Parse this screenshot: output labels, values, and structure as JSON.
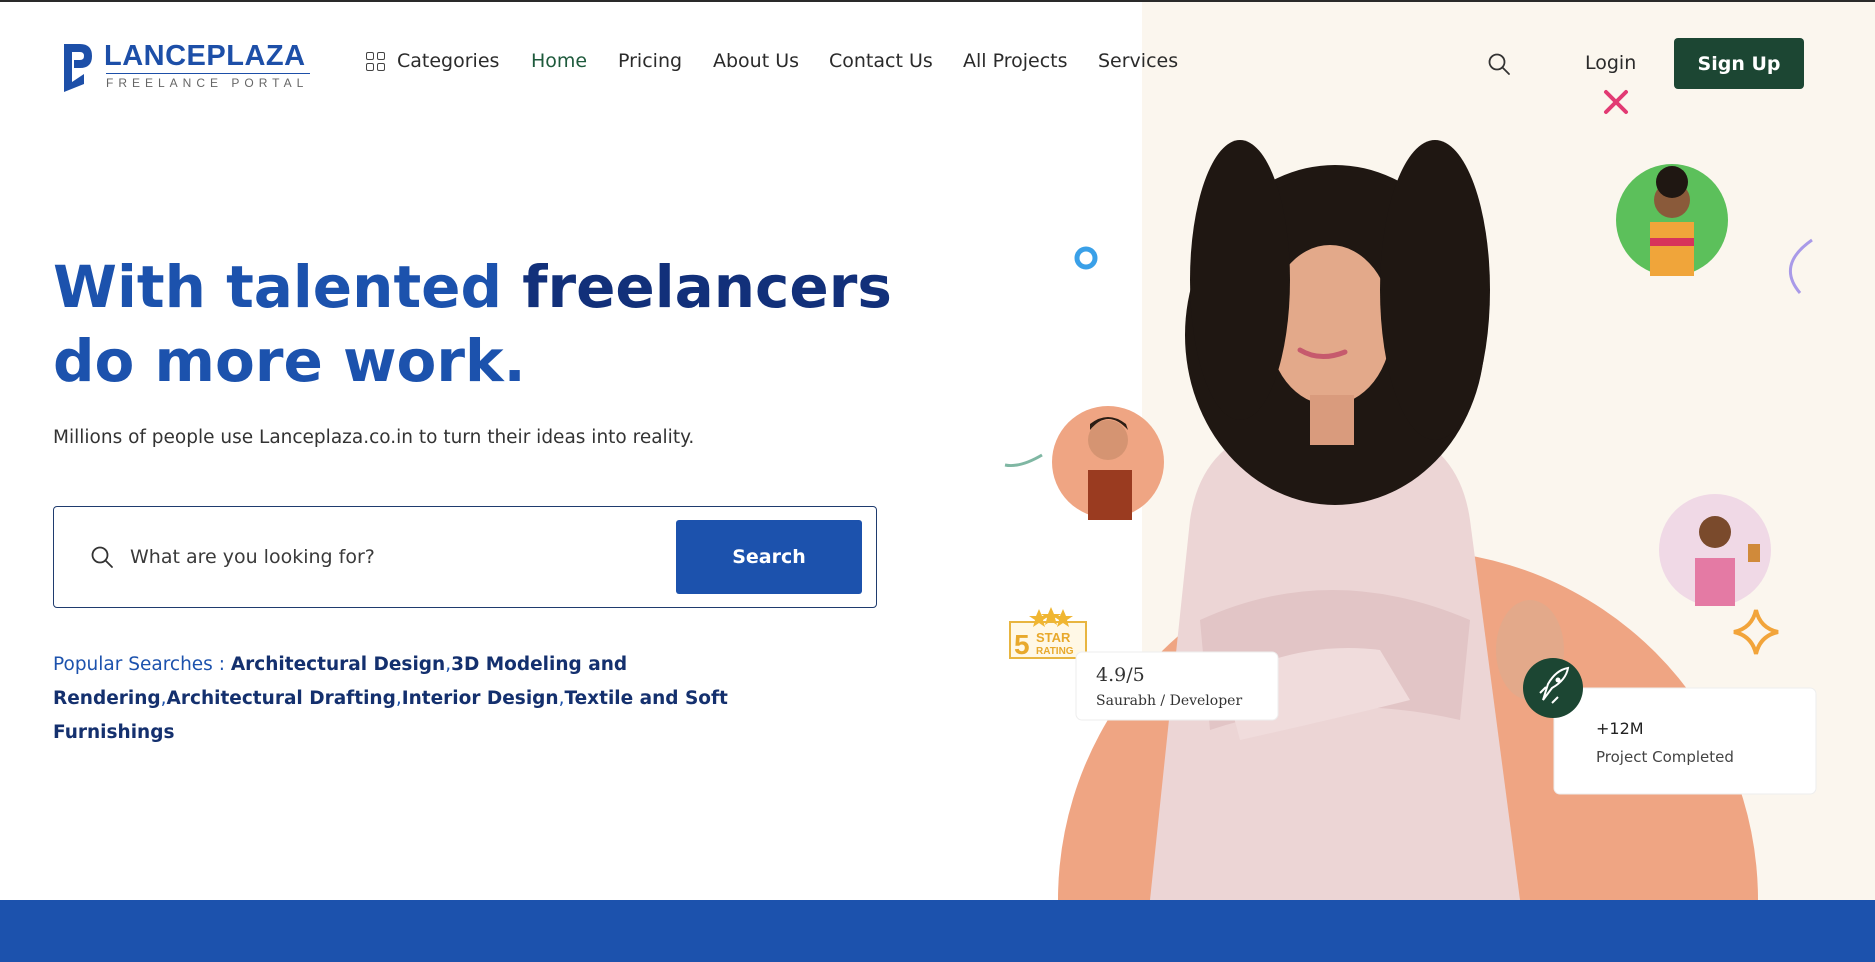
{
  "logo": {
    "name": "LANCEPLAZA",
    "tagline": "FREELANCE PORTAL"
  },
  "nav": {
    "categories": "Categories",
    "items": [
      "Home",
      "Pricing",
      "About Us",
      "Contact Us",
      "All Projects",
      "Services"
    ],
    "active": "Home",
    "login": "Login",
    "signup": "Sign Up"
  },
  "hero": {
    "title_line1_a": "With talented",
    "title_line1_b": "freelancers",
    "title_line2": "do more work.",
    "subtitle": "Millions of people use Lanceplaza.co.in to turn their ideas into reality."
  },
  "search": {
    "placeholder": "What are you looking for?",
    "button": "Search"
  },
  "popular": {
    "label": "Popular Searches :",
    "tags": [
      "Architectural Design",
      "3D Modeling and Rendering",
      "Architectural Drafting",
      "Interior Design",
      "Textile and Soft Furnishings"
    ]
  },
  "cards": {
    "rating_value": "4.9/5",
    "rating_person": "Saurabh / Developer",
    "badge_number": "5",
    "badge_line1": "STAR",
    "badge_line2": "RATING",
    "projects_value": "+12M",
    "projects_label": "Project Completed"
  },
  "colors": {
    "primary": "#1c52ad",
    "dark_green": "#1c4633",
    "navy": "#12307a",
    "accent_peach": "#efa583"
  },
  "icons": [
    "grid-icon",
    "search-icon",
    "rocket-icon",
    "close-icon",
    "sparkle-icon",
    "star-icon"
  ]
}
